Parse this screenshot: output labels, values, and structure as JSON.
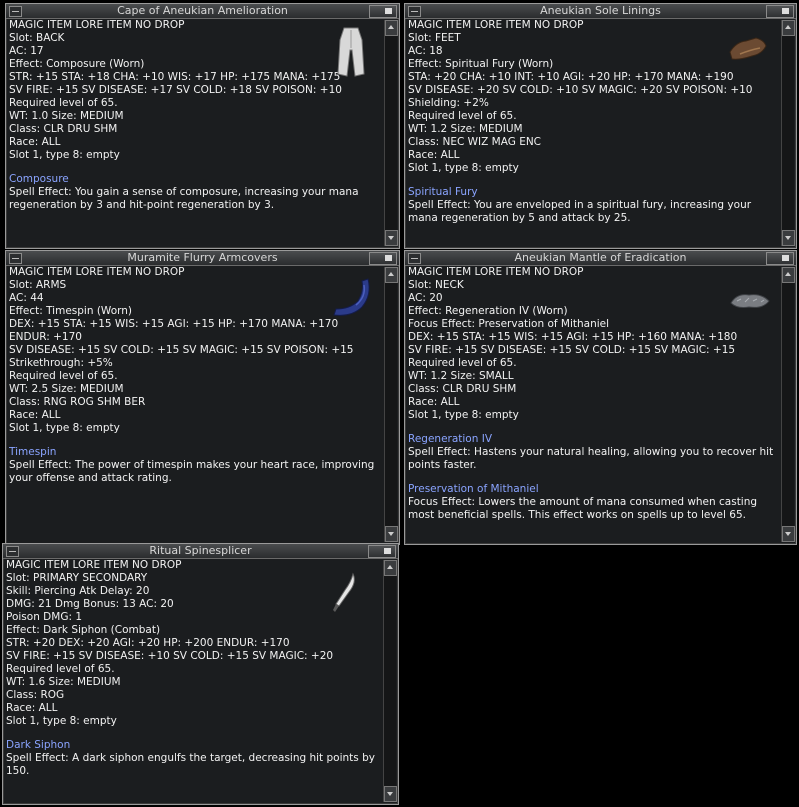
{
  "windows": [
    {
      "title": "Cape of Aneukian Amelioration",
      "icon": "cape-icon",
      "lines": [
        "MAGIC ITEM LORE ITEM NO DROP",
        "Slot: BACK",
        "AC: 17",
        "Effect: Composure (Worn)",
        "STR: +15 STA: +18 CHA: +10 WIS: +17 HP: +175 MANA: +175",
        "SV FIRE: +15 SV DISEASE: +17 SV COLD: +18 SV POISON: +10",
        "Required level of 65.",
        "WT: 1.0 Size: MEDIUM",
        "Class: CLR DRU SHM",
        "Race: ALL",
        "Slot 1, type 8: empty"
      ],
      "spells": [
        {
          "name": "Composure",
          "desc": "Spell Effect: You gain a sense of composure, increasing your mana regeneration by 3 and hit-point regeneration by 3."
        }
      ]
    },
    {
      "title": "Aneukian Sole Linings",
      "icon": "boots-icon",
      "lines": [
        "MAGIC ITEM LORE ITEM NO DROP",
        "Slot: FEET",
        "AC: 18",
        "Effect: Spiritual Fury (Worn)",
        "STA: +20 CHA: +10 INT: +10 AGI: +20 HP: +170 MANA: +190",
        "SV DISEASE: +20 SV COLD: +10 SV MAGIC: +20 SV POISON: +10",
        "Shielding: +2%",
        "Required level of 65.",
        "WT: 1.2 Size: MEDIUM",
        "Class: NEC WIZ MAG ENC",
        "Race: ALL",
        "Slot 1, type 8: empty"
      ],
      "spells": [
        {
          "name": "Spiritual Fury",
          "desc": "Spell Effect: You are enveloped in a spiritual fury, increasing your mana regeneration by 5 and attack by 25."
        }
      ]
    },
    {
      "title": "Muramite Flurry Armcovers",
      "icon": "armcovers-icon",
      "lines": [
        "MAGIC ITEM LORE ITEM NO DROP",
        "Slot: ARMS",
        "AC: 44",
        "Effect: Timespin (Worn)",
        "DEX: +15 STA: +15 WIS: +15 AGI: +15 HP: +170 MANA: +170",
        "ENDUR: +170",
        "SV DISEASE: +15 SV COLD: +15 SV MAGIC: +15 SV POISON: +15",
        "Strikethrough: +5%",
        "Required level of 65.",
        "WT: 2.5 Size: MEDIUM",
        "Class: RNG ROG SHM BER",
        "Race: ALL",
        "Slot 1, type 8: empty"
      ],
      "spells": [
        {
          "name": "Timespin",
          "desc": "Spell Effect: The power of timespin makes your heart race, improving your offense and attack rating."
        }
      ]
    },
    {
      "title": "Aneukian Mantle of Eradication",
      "icon": "mantle-icon",
      "lines": [
        "MAGIC ITEM LORE ITEM NO DROP",
        "Slot: NECK",
        "AC: 20",
        "Effect: Regeneration IV (Worn)",
        "Focus Effect: Preservation of Mithaniel",
        "DEX: +15 STA: +15 WIS: +15 AGI: +15 HP: +160 MANA: +180",
        "SV FIRE: +15 SV DISEASE: +15 SV COLD: +15 SV MAGIC: +15",
        "Required level of 65.",
        "WT: 1.2 Size: SMALL",
        "Class: CLR DRU SHM",
        "Race: ALL",
        "Slot 1, type 8: empty"
      ],
      "spells": [
        {
          "name": "Regeneration IV",
          "desc": "Spell Effect: Hastens your natural healing, allowing you to recover hit points faster."
        },
        {
          "name": "Preservation of Mithaniel",
          "desc": "Focus Effect: Lowers the amount of mana consumed when casting most beneficial spells. This effect works on spells up to level 65."
        }
      ]
    },
    {
      "title": "Ritual Spinesplicer",
      "icon": "dagger-icon",
      "lines": [
        "MAGIC ITEM LORE ITEM NO DROP",
        "Slot: PRIMARY SECONDARY",
        "Skill: Piercing Atk Delay: 20",
        "DMG: 21 Dmg Bonus: 13 AC: 20",
        "Poison DMG: 1",
        "Effect: Dark Siphon (Combat)",
        "STR: +20 DEX: +20 AGI: +20 HP: +200 ENDUR: +170",
        "SV FIRE: +15 SV DISEASE: +10 SV COLD: +15 SV MAGIC: +20",
        "Required level of 65.",
        "WT: 1.6 Size: MEDIUM",
        "Class: ROG",
        "Race: ALL",
        "Slot 1, type 8: empty"
      ],
      "spells": [
        {
          "name": "Dark Siphon",
          "desc": "Spell Effect: A dark siphon engulfs the target, decreasing hit points by 150."
        }
      ]
    }
  ]
}
